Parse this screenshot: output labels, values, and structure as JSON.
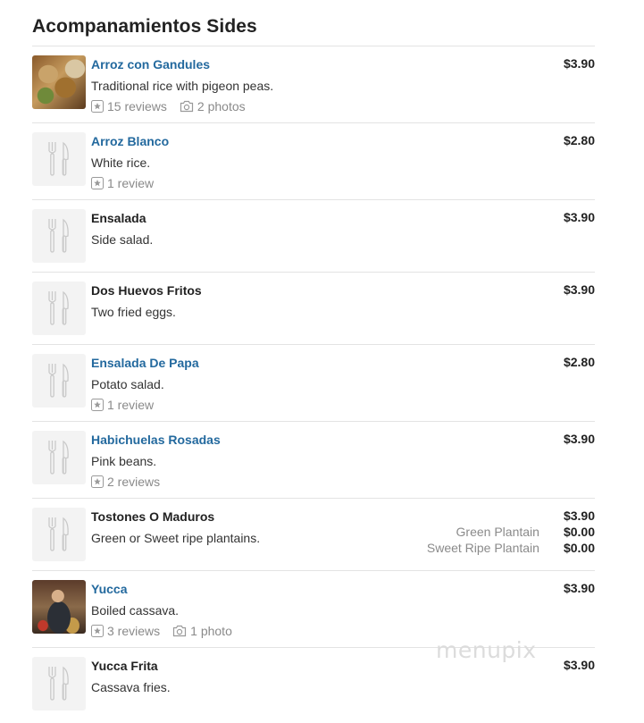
{
  "section": {
    "title": "Acompanamientos Sides"
  },
  "items": [
    {
      "name": "Arroz con Gandules",
      "link": true,
      "desc": "Traditional rice with pigeon peas.",
      "reviews": "15 reviews",
      "photos": "2 photos",
      "price": "$3.90",
      "image": "food-photo"
    },
    {
      "name": "Arroz Blanco",
      "link": true,
      "desc": "White rice.",
      "reviews": "1 review",
      "price": "$2.80",
      "image": "utensils-placeholder"
    },
    {
      "name": "Ensalada",
      "link": false,
      "desc": "Side salad.",
      "price": "$3.90",
      "image": "utensils-placeholder"
    },
    {
      "name": "Dos Huevos Fritos",
      "link": false,
      "desc": "Two fried eggs.",
      "price": "$3.90",
      "image": "utensils-placeholder"
    },
    {
      "name": "Ensalada De Papa",
      "link": true,
      "desc": "Potato salad.",
      "reviews": "1 review",
      "price": "$2.80",
      "image": "utensils-placeholder"
    },
    {
      "name": "Habichuelas Rosadas",
      "link": true,
      "desc": "Pink beans.",
      "reviews": "2 reviews",
      "price": "$3.90",
      "image": "utensils-placeholder"
    },
    {
      "name": "Tostones O Maduros",
      "link": false,
      "desc": "Green or Sweet ripe plantains.",
      "price": "$3.90",
      "image": "utensils-placeholder",
      "options": [
        {
          "label": "Green Plantain",
          "price": "$0.00"
        },
        {
          "label": "Sweet Ripe Plantain",
          "price": "$0.00"
        }
      ]
    },
    {
      "name": "Yucca",
      "link": true,
      "desc": "Boiled cassava.",
      "reviews": "3 reviews",
      "photos": "1 photo",
      "price": "$3.90",
      "image": "people-photo"
    },
    {
      "name": "Yucca Frita",
      "link": false,
      "desc": "Cassava fries.",
      "price": "$3.90",
      "image": "utensils-placeholder"
    }
  ],
  "watermark": "menupix",
  "colors": {
    "link": "#23699e",
    "text": "#222222",
    "muted": "#8a8a8a",
    "divider": "#e3e3e3"
  }
}
